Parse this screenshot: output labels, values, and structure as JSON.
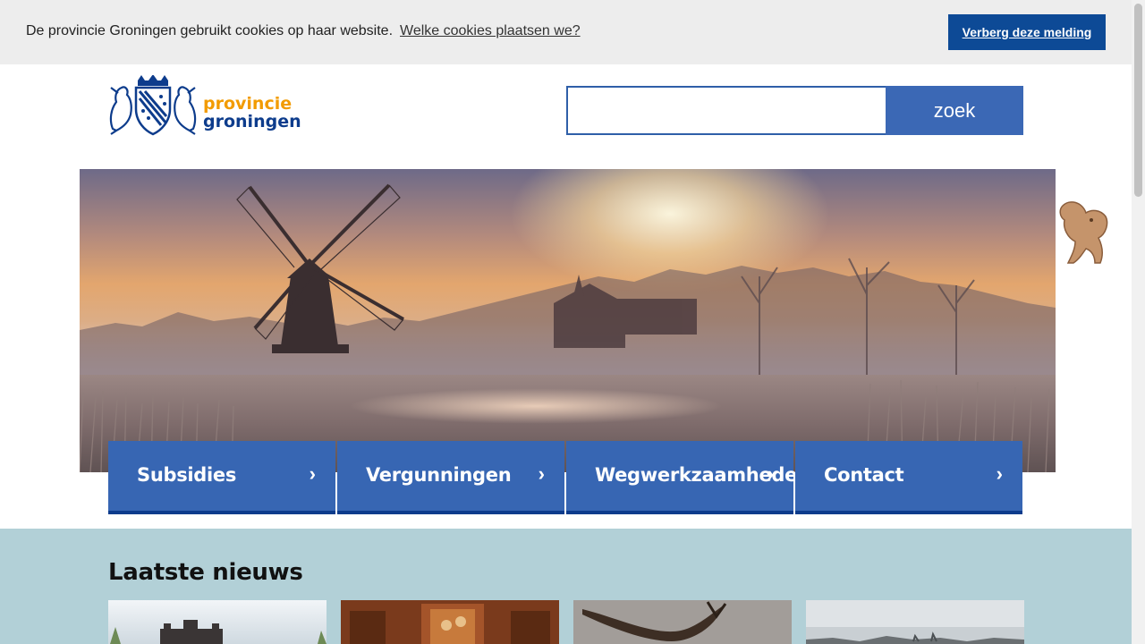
{
  "cookie_bar": {
    "message": "De provincie Groningen gebruikt cookies op haar website.",
    "link": "Welke cookies plaatsen we?",
    "button": "Verberg deze melding"
  },
  "header": {
    "logo_line1": "provincie",
    "logo_line2": "groningen",
    "search_value": "",
    "search_button": "zoek"
  },
  "nav_tiles": [
    {
      "label": "Subsidies",
      "chevron": "›"
    },
    {
      "label": "Vergunningen",
      "chevron": "›"
    },
    {
      "label": "Wegwerkzaamheden",
      "chevron": "›"
    },
    {
      "label": "Contact",
      "chevron": "›"
    }
  ],
  "news": {
    "title": "Laatste nieuws"
  },
  "colors": {
    "brand_blue": "#0d3c8c",
    "tile_blue": "#3766b3",
    "brand_orange": "#f29b00",
    "news_bg": "#b2d0d7",
    "cookie_bg": "#ededed"
  },
  "icons": [
    "coat-of-arms-logo",
    "chevron-right-icon",
    "lion-icon"
  ]
}
